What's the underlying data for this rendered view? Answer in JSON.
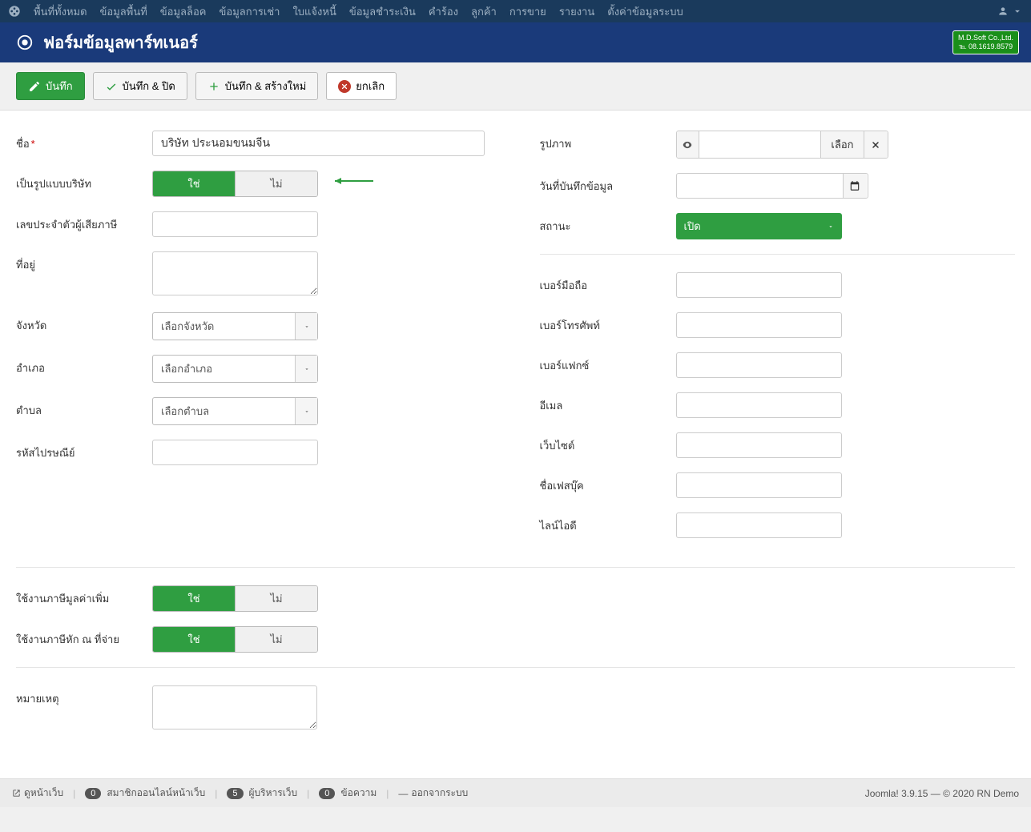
{
  "topnav": {
    "items": [
      "พื้นที่ทั้งหมด",
      "ข้อมูลพื้นที่",
      "ข้อมูลล็อค",
      "ข้อมูลการเช่า",
      "ใบแจ้งหนี้",
      "ข้อมูลชำระเงิน",
      "คำร้อง",
      "ลูกค้า",
      "การขาย",
      "รายงาน",
      "ตั้งค่าข้อมูลระบบ"
    ]
  },
  "header": {
    "title": "ฟอร์มข้อมูลพาร์ทเนอร์",
    "brand_line1": "M.D.Soft Co.,Ltd.",
    "brand_line2": "℡ 08.1619.8579"
  },
  "toolbar": {
    "save": "บันทึก",
    "save_close": "บันทึก & ปิด",
    "save_new": "บันทึก & สร้างใหม่",
    "cancel": "ยกเลิก"
  },
  "labels": {
    "name": "ชื่อ",
    "is_company": "เป็นรูปแบบบริษัท",
    "tax_id": "เลขประจำตัวผู้เสียภาษี",
    "address": "ที่อยู่",
    "province": "จังหวัด",
    "district": "อำเภอ",
    "subdistrict": "ตำบล",
    "postcode": "รหัสไปรษณีย์",
    "image": "รูปภาพ",
    "record_date": "วันที่บันทึกข้อมูล",
    "status": "สถานะ",
    "mobile": "เบอร์มือถือ",
    "phone": "เบอร์โทรศัพท์",
    "fax": "เบอร์แฟกซ์",
    "email": "อีเมล",
    "website": "เว็บไซต์",
    "facebook": "ชื่อเฟสบุ๊ค",
    "line": "ไลน์ไอดี",
    "vat_enabled": "ใช้งานภาษีมูลค่าเพิ่ม",
    "wht_enabled": "ใช้งานภาษีหัก ณ ที่จ่าย",
    "note": "หมายเหตุ"
  },
  "values": {
    "name": "บริษัท ประนอมขนมจีน",
    "yes": "ใช่",
    "no": "ไม่",
    "province_placeholder": "เลือกจังหวัด",
    "district_placeholder": "เลือกอำเภอ",
    "subdistrict_placeholder": "เลือกตำบล",
    "image_choose": "เลือก",
    "status_value": "เปิด"
  },
  "footer": {
    "preview": "ดูหน้าเว็บ",
    "visitors_count": "0",
    "visitors_label": "สมาชิกออนไลน์หน้าเว็บ",
    "admins_count": "5",
    "admins_label": "ผู้บริหารเว็บ",
    "messages_count": "0",
    "messages_label": "ข้อความ",
    "logout": "ออกจากระบบ",
    "right": "Joomla! 3.9.15  —  © 2020 RN Demo"
  }
}
